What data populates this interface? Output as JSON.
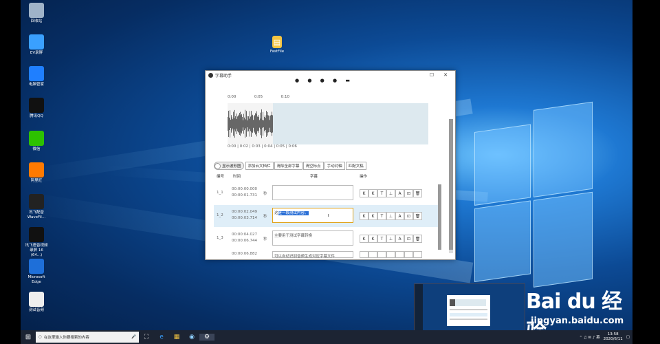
{
  "desktop": {
    "icons": [
      {
        "label": "回收站",
        "icon": "recycle-bin-icon",
        "color": "#9fb3c8"
      },
      {
        "label": "EV录屏",
        "icon": "ev-recorder-icon",
        "color": "#3aa0ff"
      },
      {
        "label": "电脑管家",
        "icon": "pc-manager-icon",
        "color": "#1f7fff"
      },
      {
        "label": "腾讯QQ",
        "icon": "qq-icon",
        "color": "#111111"
      },
      {
        "label": "微信",
        "icon": "wechat-icon",
        "color": "#2dc100"
      },
      {
        "label": "阿里旺",
        "icon": "aliwang-icon",
        "color": "#ff7a00"
      },
      {
        "label": "讯飞配音\nWaveFil...",
        "icon": "audio-bars-icon",
        "color": "#222222"
      },
      {
        "label": "讯飞语音视频\n录屏 16 (64...)",
        "icon": "video-camera-icon",
        "color": "#111111"
      },
      {
        "label": "Microsoft\nEdge",
        "icon": "edge-icon",
        "color": "#1e6fd9"
      },
      {
        "label": "测试音频",
        "icon": "audio-file-icon",
        "color": "#eeeeee"
      }
    ],
    "folder": {
      "label": "FastFile",
      "icon": "folder-icon"
    }
  },
  "window": {
    "title": "字幕助手",
    "maximize": "☐",
    "close": "✕",
    "dots": "● ● ● ● ▬",
    "timeline_ticks": [
      "0:00",
      "0:05",
      "0:10"
    ],
    "wave_labels": "0:00 | 0:02 | 0:03 | 0:04 | 0:05 | 0:06",
    "toggle_label": "显示波形图",
    "tabs": [
      "添加云文档栏",
      "清除全部字幕",
      "清空标点",
      "手动对轴",
      "匹配文稿"
    ],
    "columns": {
      "index": "编号",
      "time": "时间",
      "subtitle": "字幕",
      "actions": "操作"
    },
    "rows": [
      {
        "index": "1_1",
        "start": "00:00:00.000",
        "end": "00:00:01.731",
        "unit": "秒",
        "text": "",
        "selected": false
      },
      {
        "index": "1_2",
        "start": "00:00:02.049",
        "end": "00:00:03.714",
        "unit": "秒",
        "text_prefix": "这",
        "text_highlight": "是一段测试内容。",
        "cursor": "I",
        "selected": true
      },
      {
        "index": "1_3",
        "start": "00:00:04.027",
        "end": "00:00:06.744",
        "unit": "秒",
        "text": "主要用于测试字幕转换",
        "selected": false
      },
      {
        "index": "",
        "start": "00:00:06.882",
        "end": "",
        "unit": "",
        "text": "可以自动识别音频生成对应字幕文件",
        "selected": false
      }
    ],
    "row_actions": [
      "K",
      "K",
      "T",
      "⊥",
      "A",
      "⊡",
      "🗑"
    ]
  },
  "taskbar": {
    "start_icon": "windows-start-icon",
    "search_placeholder": "在这里输入你要搜索的内容",
    "apps": [
      "⛶",
      "e",
      "▦",
      "◉",
      "⚙"
    ],
    "tray_icons": "⌃ ♫ ✉ ♪ 英",
    "time": "13:58",
    "date": "2020/6/11",
    "notification": "▢"
  },
  "watermark": {
    "text": "Bai du 经验",
    "sub": "jingyan.baidu.com"
  },
  "colors": {
    "accent": "#2a6fd6",
    "selection": "#dfeef8",
    "wave_selection": "#dde9ef",
    "taskbar": "#1c2433"
  }
}
